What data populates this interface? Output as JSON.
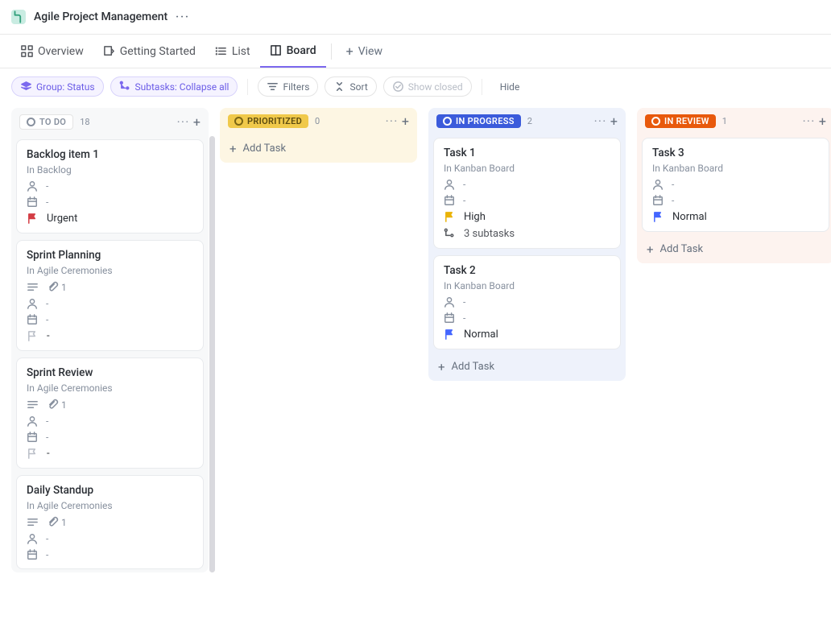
{
  "header": {
    "title": "Agile Project Management"
  },
  "tabs": {
    "overview": "Overview",
    "getting_started": "Getting Started",
    "list": "List",
    "board": "Board",
    "add_view": "View"
  },
  "filters": {
    "group": "Group: Status",
    "subtasks": "Subtasks: Collapse all",
    "filters": "Filters",
    "sort": "Sort",
    "show_closed": "Show closed",
    "hide": "Hide"
  },
  "add_task_label": "Add Task",
  "columns": [
    {
      "key": "todo",
      "label": "TO DO",
      "count": "18",
      "cards": [
        {
          "title": "Backlog item 1",
          "location": "In Backlog",
          "assignee": "-",
          "date": "-",
          "priority": "Urgent",
          "priority_key": "urgent"
        },
        {
          "title": "Sprint Planning",
          "location": "In Agile Ceremonies",
          "has_desc": true,
          "attachments": "1",
          "assignee": "-",
          "date": "-",
          "priority": "-",
          "priority_key": "none"
        },
        {
          "title": "Sprint Review",
          "location": "In Agile Ceremonies",
          "has_desc": true,
          "attachments": "1",
          "assignee": "-",
          "date": "-",
          "priority": "-",
          "priority_key": "none"
        },
        {
          "title": "Daily Standup",
          "location": "In Agile Ceremonies",
          "has_desc": true,
          "attachments": "1",
          "assignee": "-",
          "date": "-"
        }
      ]
    },
    {
      "key": "prioritized",
      "label": "PRIORITIZED",
      "count": "0",
      "cards": []
    },
    {
      "key": "inprogress",
      "label": "IN PROGRESS",
      "count": "2",
      "cards": [
        {
          "title": "Task 1",
          "location": "In Kanban Board",
          "assignee": "-",
          "date": "-",
          "priority": "High",
          "priority_key": "high",
          "subtasks": "3 subtasks"
        },
        {
          "title": "Task 2",
          "location": "In Kanban Board",
          "assignee": "-",
          "date": "-",
          "priority": "Normal",
          "priority_key": "normal"
        }
      ]
    },
    {
      "key": "inreview",
      "label": "IN REVIEW",
      "count": "1",
      "cards": [
        {
          "title": "Task 3",
          "location": "In Kanban Board",
          "assignee": "-",
          "date": "-",
          "priority": "Normal",
          "priority_key": "normal"
        }
      ]
    }
  ]
}
